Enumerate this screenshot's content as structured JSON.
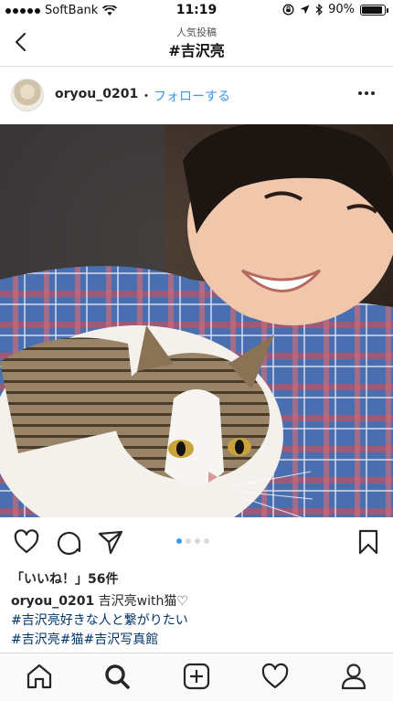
{
  "status_bar": {
    "carrier": "SoftBank",
    "time": "11:19",
    "battery_percent": "90%",
    "battery_level": 0.9,
    "icons": [
      "signal-dots-icon",
      "wifi-icon",
      "lock-rotation-icon",
      "location-icon",
      "bluetooth-icon",
      "battery-icon"
    ]
  },
  "header": {
    "subtitle": "人気投稿",
    "title": "#吉沢亮",
    "back_icon": "back-chevron-icon"
  },
  "post": {
    "username": "oryou_0201",
    "separator": "・",
    "follow_label": "フォローする",
    "more_icon": "more-options-icon",
    "image": {
      "subject": "photo",
      "carousel_count": 4,
      "carousel_active": 0
    },
    "likes_text": "「いいね！」56件",
    "caption_user": "oryou_0201",
    "caption_text": "吉沢亮with猫♡",
    "hashtags_line1": "#吉沢亮好きな人と繋がりたい",
    "hashtags_line2": "#吉沢亮#猫#吉沢写真館"
  },
  "colors": {
    "link": "#3897f0",
    "hashtag": "#003569",
    "divider": "#dbdbdb"
  },
  "tab_bar": {
    "icons": [
      "home-icon",
      "search-icon",
      "add-post-icon",
      "activity-heart-icon",
      "profile-icon"
    ],
    "active": "search-icon"
  }
}
